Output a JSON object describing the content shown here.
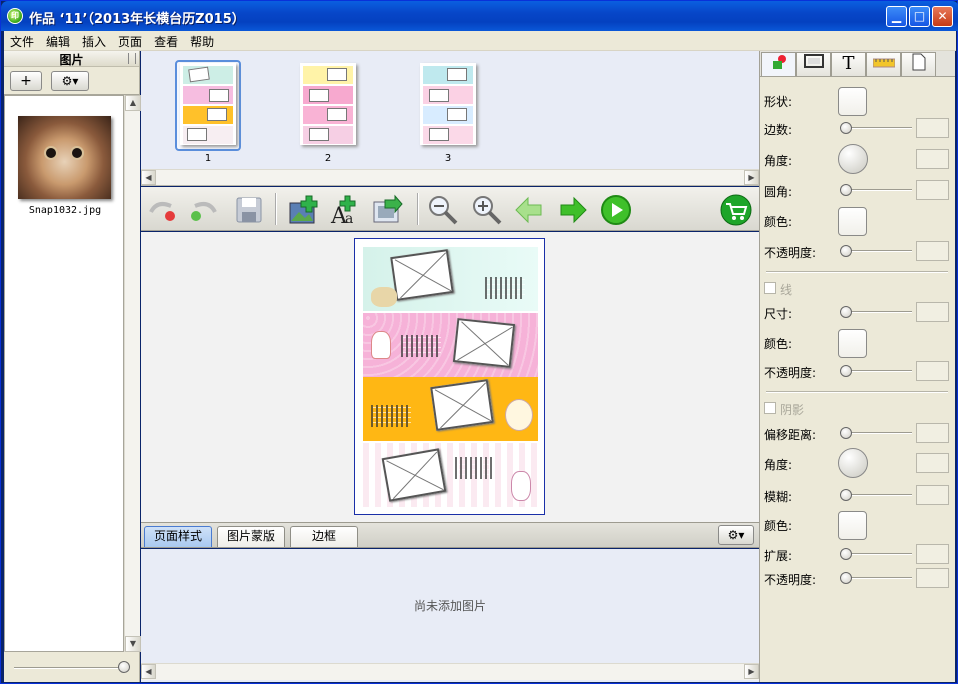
{
  "window": {
    "title": "作品 ‘11’（2013年长横台历Z015）",
    "app_icon_text": "印"
  },
  "menu": [
    "文件",
    "编辑",
    "插入",
    "页面",
    "查看",
    "帮助"
  ],
  "left_panel": {
    "header": "图片",
    "add_label": "+",
    "settings_label": "⚙▾",
    "photo_caption": "Snap1032.jpg"
  },
  "thumbnails": [
    "1",
    "2",
    "3"
  ],
  "toolbar_icons": [
    "undo-icon",
    "redo-icon",
    "save-icon",
    "add-photo-icon",
    "add-text-icon",
    "replace-photo-icon",
    "zoom-out-icon",
    "zoom-in-icon",
    "previous-page-icon",
    "next-page-icon",
    "play-icon",
    "cart-icon"
  ],
  "bottom_tabs": [
    "页面样式",
    "图片蒙版",
    "边框"
  ],
  "empty_message": "尚未添加图片",
  "right_panel": {
    "tabs": [
      "shape-icon",
      "frame-icon",
      "T",
      "ruler-icon",
      "page-icon"
    ],
    "shape": "形状:",
    "sides": "边数:",
    "angle": "角度:",
    "corner": "圆角:",
    "color": "颜色:",
    "opacity": "不透明度:",
    "line": "线",
    "size": "尺寸:",
    "line_color": "颜色:",
    "line_opacity": "不透明度:",
    "shadow": "阴影",
    "offset": "偏移距离:",
    "shadow_angle": "角度:",
    "blur": "模糊:",
    "shadow_color": "颜色:",
    "spread": "扩展:",
    "shadow_opacity": "不透明度:"
  },
  "colors": {
    "titlebar": "#0746c8",
    "panel": "#ece9d8",
    "canvas": "#e8ecf6",
    "accent": "#1a2fa8"
  }
}
